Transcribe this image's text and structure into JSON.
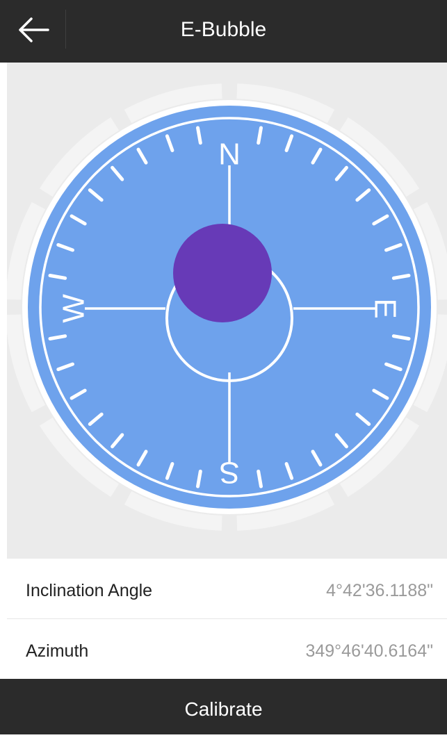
{
  "header": {
    "title": "E-Bubble",
    "back_icon": "arrow-left-icon"
  },
  "compass": {
    "north": "N",
    "east": "E",
    "south": "S",
    "west": "W",
    "colors": {
      "dial": "#6ea2ec",
      "rim": "#ffffff",
      "bubble": "#673ab7",
      "background": "#ebebeb"
    }
  },
  "readings": [
    {
      "label": "Inclination Angle",
      "value": "4°42'36.1188\""
    },
    {
      "label": "Azimuth",
      "value": "349°46'40.6164\""
    }
  ],
  "footer": {
    "calibrate_label": "Calibrate"
  }
}
